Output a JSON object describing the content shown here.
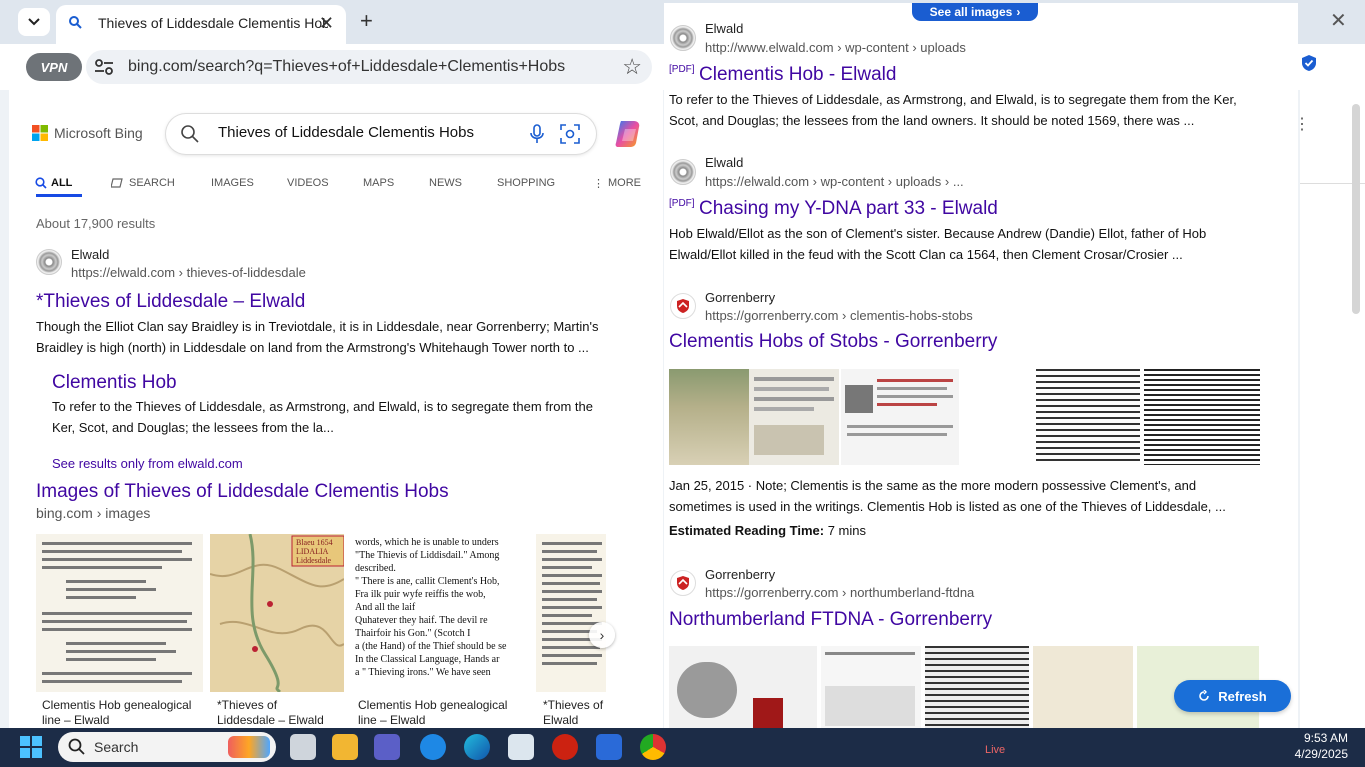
{
  "browser": {
    "tab_title": "Thieves of Liddesdale Clementis Hobs",
    "url": "bing.com/search?q=Thieves+of+Liddesdale+Clementis+Hobs",
    "vpn_label": "VPN"
  },
  "bing": {
    "brand": "Microsoft Bing",
    "query": "Thieves of Liddesdale Clementis Hobs",
    "nav": [
      "ALL",
      "SEARCH",
      "IMAGES",
      "VIDEOS",
      "MAPS",
      "NEWS",
      "SHOPPING",
      "MORE"
    ],
    "results_count": "About 17,900 results",
    "result1": {
      "site": "Elwald",
      "url": "https://elwald.com › thieves-of-liddesdale",
      "title": "*Thieves of Liddesdale – Elwald",
      "snippet": "Though the Elliot Clan say Braidley is in Treviotdale, it is in Liddesdale, near Gorrenberry; Martin's Braidley is high (north) in Liddesdale on land from the Armstrong's Whitehaugh Tower north to ...",
      "sub_title": "Clementis Hob",
      "sub_snippet": "To refer to the Thieves of Liddesdale, as Armstrong, and Elwald, is to segregate them from the Ker, Scot, and Douglas; the lessees from the la...",
      "see_only": "See results only from elwald.com"
    },
    "images": {
      "title": "Images of Thieves of Liddesdale Clementis Hobs",
      "url": "bing.com › images",
      "captions": [
        "Clementis Hob genealogical line – Elwald",
        "*Thieves of Liddesdale – Elwald",
        "Clementis Hob genealogical line – Elwald",
        "*Thieves of Elwald"
      ],
      "map_label": "Blaeu 1654 LIDALIA Liddesdale",
      "quote_lines": [
        "words, which he is unable to unders",
        "\"The Thievis of Liddisdail.\"  Among",
        "described.",
        "\" There is ane, callit Clement's Hob,",
        "  Fra ilk puir wyfe reiffis the wob,",
        "  And all the laif",
        "  Quhatever they haif.  The devil re",
        "  Thairfoir his Gon.\"        (Scotch I",
        "a (the Hand) of the Thief should be se",
        "  In the Classical Language, Hands ar",
        "a \" Thieving irons.\"   We have seen"
      ]
    }
  },
  "right_pane": {
    "see_all": "See all images",
    "results": [
      {
        "site": "Elwald",
        "url": "http://www.elwald.com › wp-content › uploads",
        "pdf": "[PDF]",
        "title": "Clementis Hob - Elwald",
        "snippet": "To refer to the Thieves of Liddesdale, as Armstrong, and Elwald, is to segregate them from the Ker, Scot, and Douglas; the lessees from the land owners. It should be noted 1569, there was ..."
      },
      {
        "site": "Elwald",
        "url": "https://elwald.com › wp-content › uploads › ...",
        "pdf": "[PDF]",
        "title": "Chasing my Y-DNA part 33 - Elwald",
        "snippet": "Hob Elwald/Ellot as the son of Clement's sister. Because Andrew (Dandie) Ellot, father of Hob Elwald/Ellot killed in the feud with the Scott Clan ca 1564, then Clement Crosar/Crosier ..."
      },
      {
        "site": "Gorrenberry",
        "url": "https://gorrenberry.com › clementis-hobs-stobs",
        "title": "Clementis Hobs of Stobs - Gorrenberry",
        "snippet": "Jan 25, 2015 · Note; Clementis is the same as the more modern possessive Clement's, and sometimes is used in the writings. Clementis Hob is listed as one of the Thieves of Liddesdale, ...",
        "reading_label": "Estimated Reading Time:",
        "reading_value": "7 mins"
      },
      {
        "site": "Gorrenberry",
        "url": "https://gorrenberry.com › northumberland-ftdna",
        "title": "Northumberland FTDNA - Gorrenberry"
      }
    ],
    "refresh": "Refresh"
  },
  "taskbar": {
    "search": "Search",
    "live": "Live",
    "time": "9:53 AM",
    "date": "4/29/2025"
  },
  "colors": {
    "link": "#4007a2",
    "accent": "#1a5dd1",
    "taskbar": "#1c2c47"
  }
}
